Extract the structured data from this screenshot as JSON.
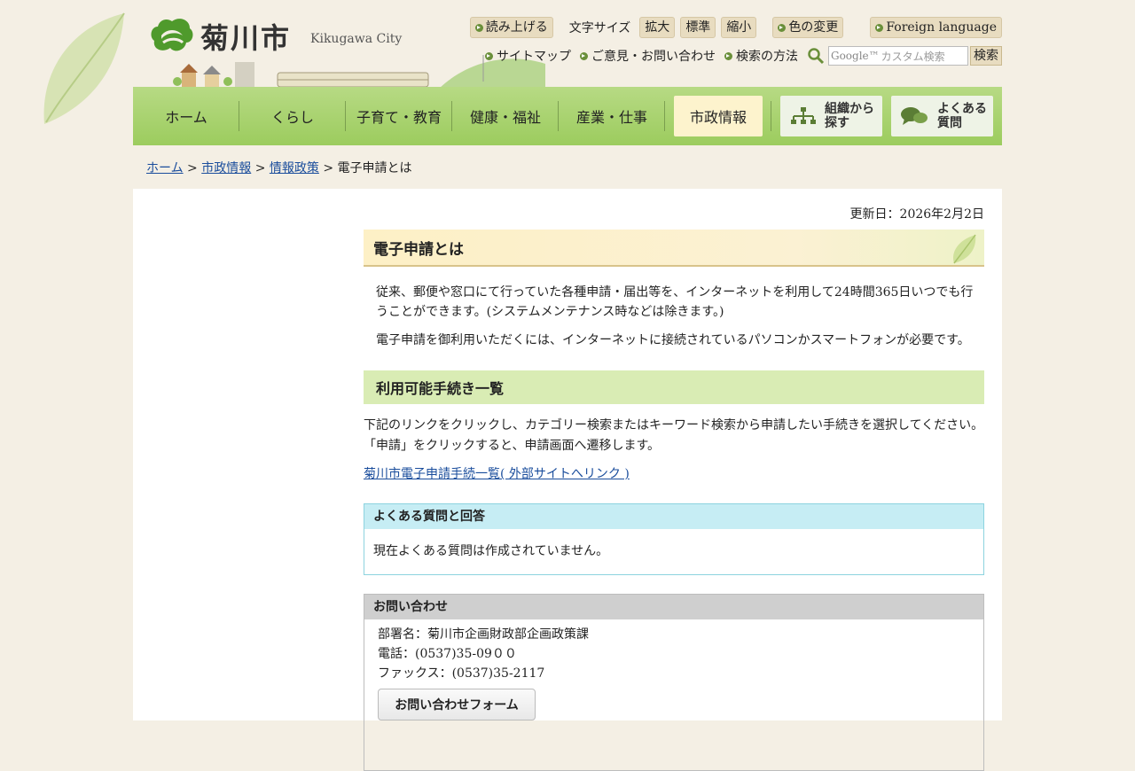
{
  "header": {
    "city_name": "菊川市",
    "city_name_en": "Kikugawa City",
    "read_aloud": "読み上げる",
    "font_size_label": "文字サイズ",
    "font_larger": "拡大",
    "font_standard": "標準",
    "font_smaller": "縮小",
    "color_change": "色の変更",
    "foreign_language": "Foreign language",
    "sitemap": "サイトマップ",
    "contact_feedback": "ご意見・お問い合わせ",
    "search_method": "検索の方法",
    "search_logo": "Google™",
    "search_placeholder": "カスタム検索",
    "search_button": "検索"
  },
  "nav": {
    "items": [
      "ホーム",
      "くらし",
      "子育て・教育",
      "健康・福祉",
      "産業・仕事",
      "市政情報"
    ],
    "active_index": 5,
    "org_search": [
      "組織から",
      "探す"
    ],
    "faq": [
      "よくある",
      "質問"
    ]
  },
  "breadcrumb": {
    "items": [
      "ホーム",
      "市政情報",
      "情報政策"
    ],
    "current": "電子申請とは",
    "separator": ">"
  },
  "main": {
    "updated": "更新日：2026年2月2日",
    "title": "電子申請とは",
    "intro_1": "従来、郵便や窓口にて行っていた各種申請・届出等を、インターネットを利用して24時間365日いつでも行うことができます。(システムメンテナンス時などは除きます。)",
    "intro_2": "電子申請を御利用いただくには、インターネットに接続されているパソコンかスマートフォンが必要です。",
    "section_title": "利用可能手続き一覧",
    "section_text_1": "下記のリンクをクリックし、カテゴリー検索またはキーワード検索から申請したい手続きを選択してください。",
    "section_text_2": "「申請」をクリックすると、申請画面へ遷移します。",
    "external_link": "菊川市電子申請手続一覧( 外部サイトへリンク )"
  },
  "faq_box": {
    "title": "よくある質問と回答",
    "body": "現在よくある質問は作成されていません。"
  },
  "contact": {
    "title": "お問い合わせ",
    "department": "部署名：菊川市企画財政部企画政策課",
    "phone": "電話：(0537)35-09００",
    "fax": "ファックス：(0537)35-2117",
    "form_button": "お問い合わせフォーム"
  },
  "colors": {
    "nav_green": "#a5cf6b",
    "link_blue": "#1a4d9c",
    "active_tab": "#fdf3cd",
    "section_green": "#d9ecb4",
    "faq_cyan": "#c6edf4"
  }
}
